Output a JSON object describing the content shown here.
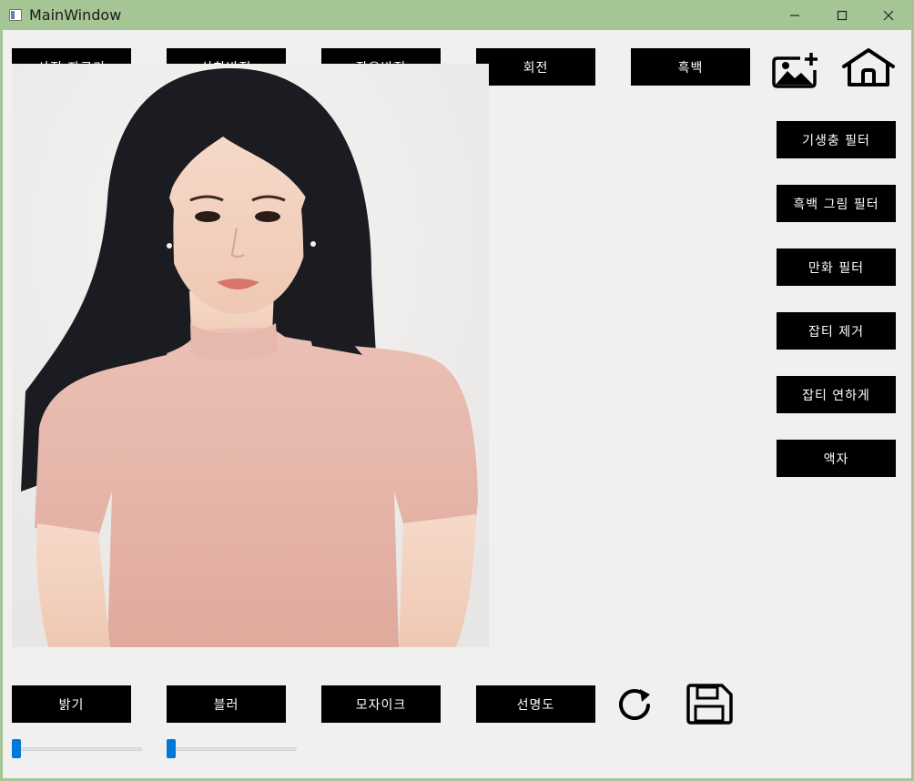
{
  "window": {
    "title": "MainWindow",
    "icons": {
      "app": "window-app-icon",
      "minimize": "minimize-icon",
      "maximize": "maximize-icon",
      "close": "close-icon"
    },
    "accent_color": "#a5c595"
  },
  "toolbar_top": {
    "crop_label": "사진 자르기",
    "flip_vertical_label": "상하반전",
    "flip_horizontal_label": "좌우반전",
    "rotate_label": "회전",
    "grayscale_label": "흑백",
    "add_image_icon": "add-image-icon",
    "home_icon": "home-icon"
  },
  "filters": {
    "parasite_label": "기생충 필터",
    "bw_drawing_label": "흑백 그림 필터",
    "cartoon_label": "만화 필터",
    "denoise_label": "잡티 제거",
    "soften_label": "잡티 연하게",
    "frame_label": "액자"
  },
  "toolbar_bottom": {
    "brightness_label": "밝기",
    "blur_label": "블러",
    "mosaic_label": "모자이크",
    "sharpness_label": "선명도",
    "reset_icon": "reset-icon",
    "save_icon": "save-icon"
  },
  "sliders": {
    "brightness_value": 0,
    "blur_value": 0
  },
  "colors": {
    "button_bg": "#000000",
    "button_text": "#ffffff",
    "slider_accent": "#0078d7",
    "shirt": "#e6b2a6",
    "hair": "#1b1c22"
  }
}
